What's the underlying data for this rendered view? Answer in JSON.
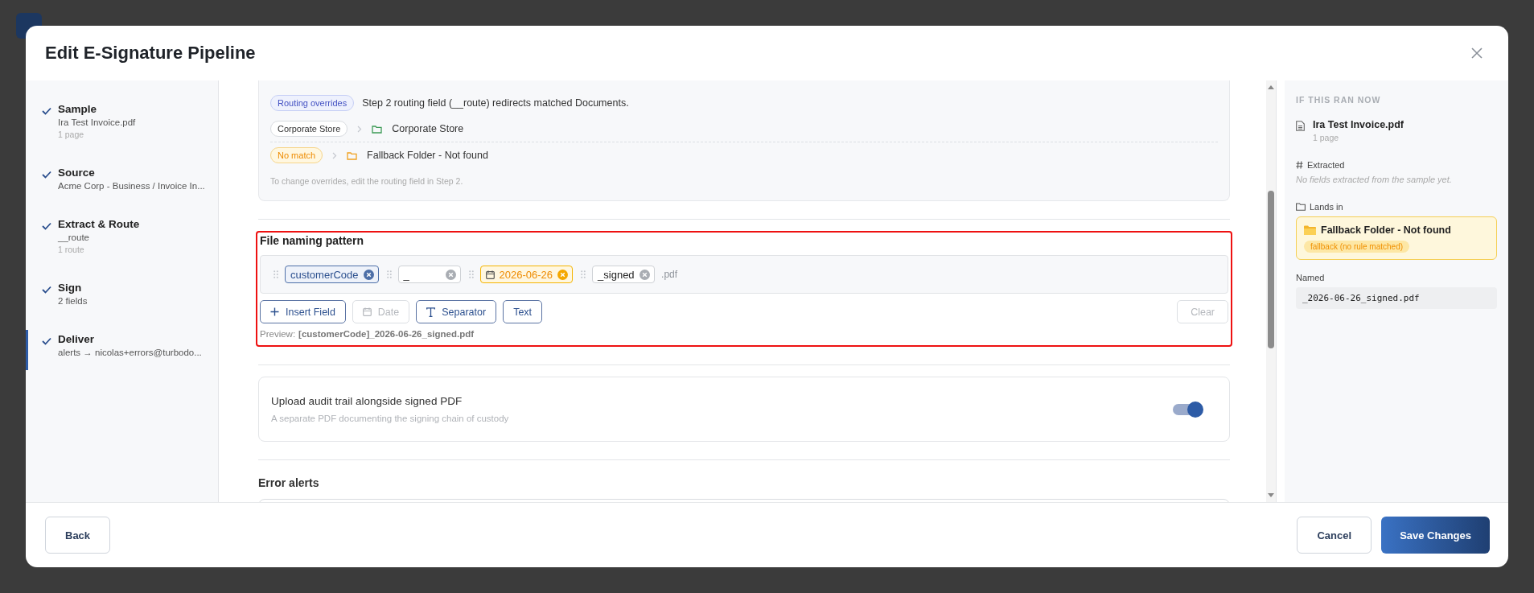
{
  "dialog": {
    "title": "Edit E-Signature Pipeline"
  },
  "steps": [
    {
      "title": "Sample",
      "detail": "Ira Test Invoice.pdf",
      "meta": "1 page",
      "done": true,
      "selected": false
    },
    {
      "title": "Source",
      "detail": "Acme Corp - Business / Invoice In...",
      "done": true,
      "selected": false
    },
    {
      "title": "Extract & Route",
      "detail": "__route",
      "meta": "1 route",
      "done": true,
      "selected": false
    },
    {
      "title": "Sign",
      "detail": "2 fields",
      "done": true,
      "selected": false
    },
    {
      "title": "Deliver",
      "detail": "alerts → nicolas+errors@turbodo...",
      "done": true,
      "selected": true
    }
  ],
  "routing": {
    "badge": "Routing overrides",
    "description": "Step 2 routing field (__route) redirects matched Documents.",
    "rules": [
      {
        "kind": "match",
        "value": "Corporate Store",
        "destination": "Corporate Store"
      },
      {
        "kind": "fallback",
        "value": "No match",
        "destination": "Fallback Folder - Not found"
      }
    ],
    "hint": "To change overrides, edit the routing field in Step 2."
  },
  "naming": {
    "title": "File naming pattern",
    "highlighted": true,
    "tokens": [
      {
        "kind": "field",
        "label": "customerCode"
      },
      {
        "kind": "separator",
        "label": "_"
      },
      {
        "kind": "date",
        "label": "2026-06-26"
      },
      {
        "kind": "text",
        "label": "_signed"
      }
    ],
    "extension": ".pdf",
    "actions": [
      {
        "kind": "field",
        "label": "Insert Field",
        "disabled": false
      },
      {
        "kind": "date",
        "label": "Date",
        "disabled": true
      },
      {
        "kind": "separator",
        "label": "Separator",
        "disabled": false
      },
      {
        "kind": "text",
        "label": "Text",
        "disabled": false
      }
    ],
    "clear": {
      "label": "Clear",
      "disabled": true
    },
    "preview_label": "Preview:",
    "preview": "[customerCode]_2026-06-26_signed.pdf"
  },
  "audit": {
    "title": "Upload audit trail alongside signed PDF",
    "description": "A separate PDF documenting the signing chain of custody",
    "on": true
  },
  "error_alerts": {
    "title": "Error alerts"
  },
  "summary": {
    "heading": "IF THIS RAN NOW",
    "file": "Ira Test Invoice.pdf",
    "pages": "1 page",
    "extracted_label": "Extracted",
    "extracted_empty": "No fields extracted from the sample yet.",
    "lands_label": "Lands in",
    "destination": "Fallback Folder - Not found",
    "destination_badge": "fallback (no rule matched)",
    "named_label": "Named",
    "named": "_2026-06-26_signed.pdf"
  },
  "footer": {
    "back": "Back",
    "cancel": "Cancel",
    "save": "Save Changes"
  }
}
